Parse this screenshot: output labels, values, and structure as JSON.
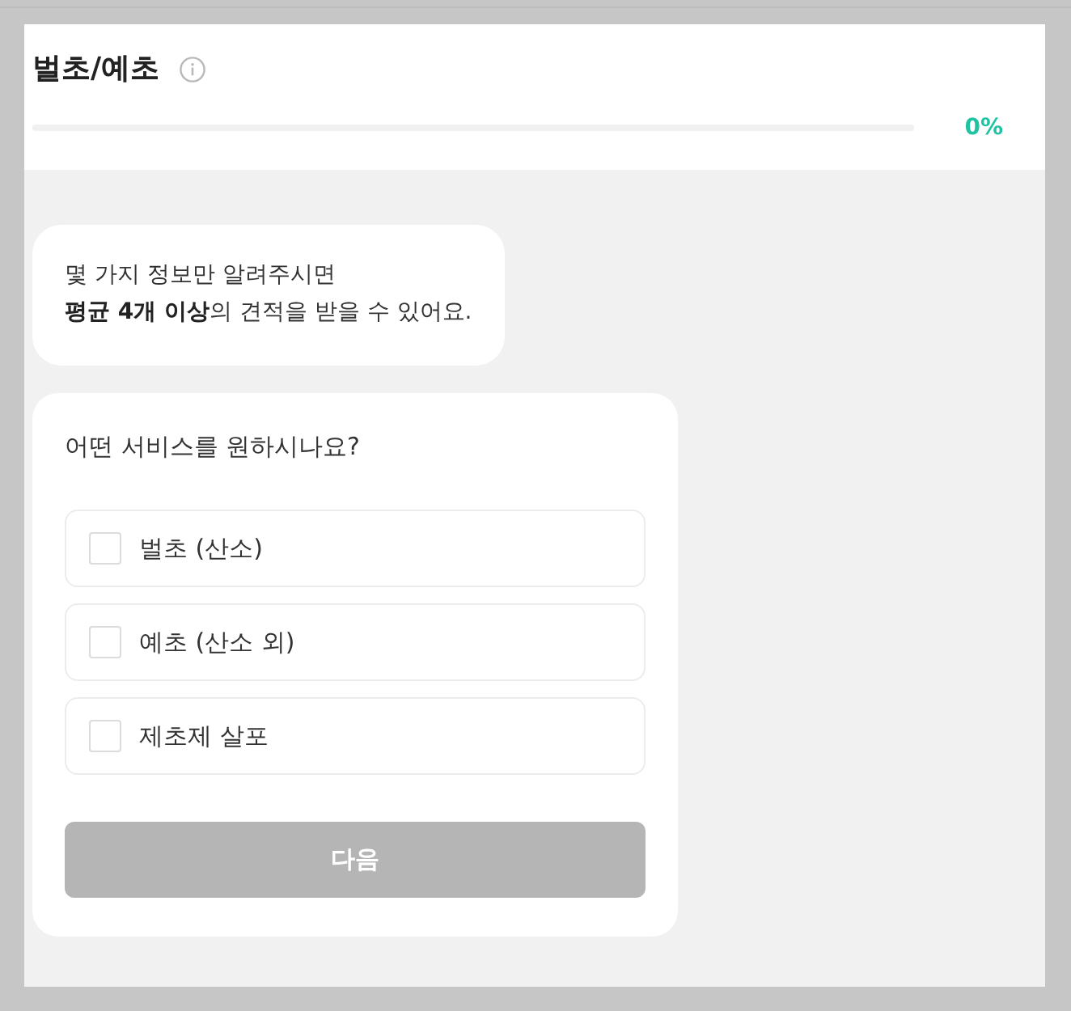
{
  "header": {
    "title": "벌초/예초",
    "progress": {
      "level": 0,
      "reading": "0%"
    }
  },
  "intro": {
    "lines": [
      "몇 가지 정보만 알려주시면",
      "**평균 4개 이상**의 견적을 받을 수 있어요."
    ]
  },
  "question": {
    "prompt": "어떤 서비스를 원하시나요?",
    "options": [
      {
        "label": "벌초 (산소)",
        "checked": false
      },
      {
        "label": "예초 (산소 외)",
        "checked": false
      },
      {
        "label": "제초제 살포",
        "checked": false
      }
    ]
  },
  "next_button": {
    "label": "다음",
    "disabled": true
  }
}
